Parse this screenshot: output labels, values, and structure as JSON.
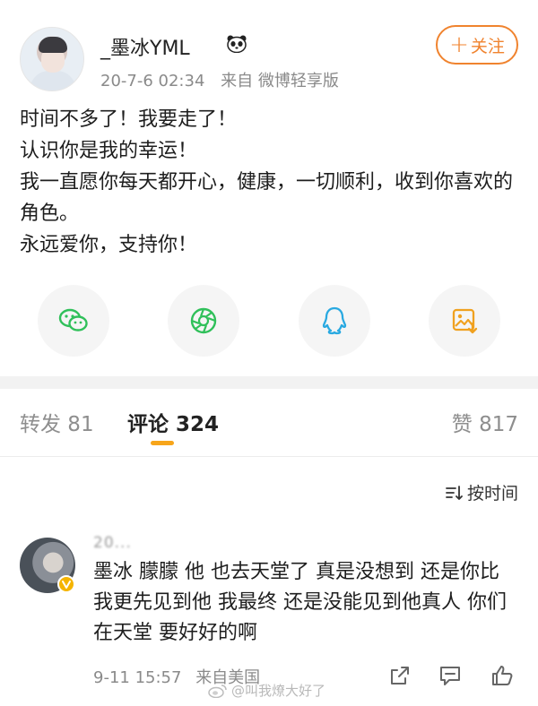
{
  "post": {
    "username": "_墨冰YML",
    "date": "20-7-6 02:34",
    "source": "来自 微博轻享版",
    "follow_label": "关注",
    "follow_plus": "+",
    "lines": [
      "时间不多了！我要走了！",
      "认识你是我的幸运！",
      "我一直愿你每天都开心，健康，一切顺利，收到你喜欢的角色。",
      "永远爱你，支持你！"
    ]
  },
  "share": {
    "icons": [
      "wechat-icon",
      "moments-icon",
      "qq-icon",
      "save-image-icon"
    ],
    "colors": {
      "wechat": "#30c05a",
      "moments": "#30c05a",
      "qq": "#29a9e1",
      "save": "#f0a11f"
    }
  },
  "tabs": {
    "repost": "转发 81",
    "comments": "评论 324",
    "likes": "赞 817"
  },
  "sort": {
    "label": "按时间"
  },
  "comment": {
    "name": "20...",
    "text": "墨冰 朦朦 他 也去天堂了 真是没想到 还是你比我更先见到他 我最终 还是没能见到他真人 你们 在天堂 要好好的啊",
    "date": "9-11 15:57",
    "source": "来自美国"
  },
  "watermark": {
    "text": "@叫我燎大好了"
  },
  "colors": {
    "accent": "#f0832e",
    "tab_underline": "#f7a51a",
    "muted_text": "#8a8a8a"
  }
}
